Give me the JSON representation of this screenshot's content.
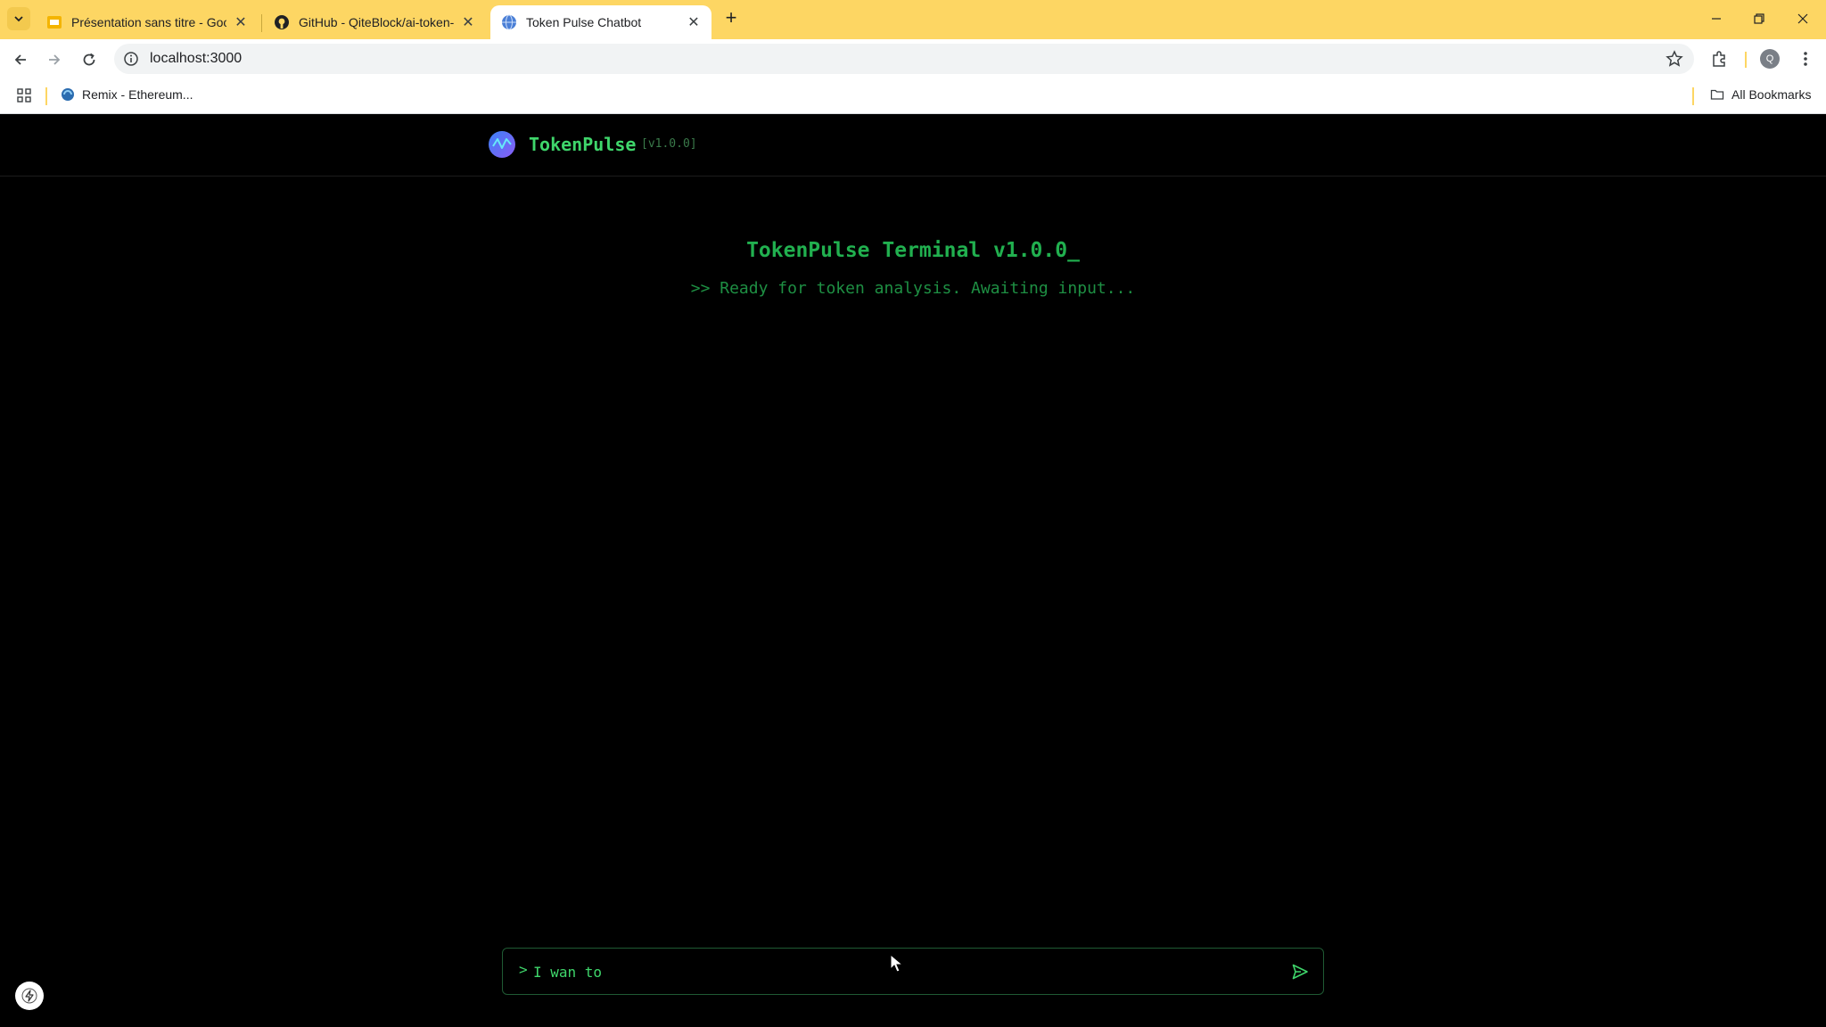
{
  "browser": {
    "tabs": [
      {
        "title": "Présentation sans titre - Goo",
        "icon": "slides-icon"
      },
      {
        "title": "GitHub - QiteBlock/ai-token-",
        "icon": "github-icon"
      },
      {
        "title": "Token Pulse Chatbot",
        "icon": "globe-icon"
      }
    ],
    "url": "localhost:3000",
    "profile_initial": "Q",
    "bookmarks": [
      {
        "label": "Remix - Ethereum...",
        "icon": "remix-icon"
      }
    ],
    "all_bookmarks_label": "All Bookmarks"
  },
  "app": {
    "brand": "TokenPulse",
    "version": "[v1.0.0]",
    "terminal_title": "TokenPulse Terminal v1.0.0_",
    "terminal_subtitle": ">> Ready for token analysis. Awaiting input...",
    "input": {
      "prompt": ">",
      "value": "I wan to"
    }
  },
  "colors": {
    "accent_green": "#3fd66b",
    "tabbar_yellow": "#fdd663",
    "background": "#000000"
  }
}
